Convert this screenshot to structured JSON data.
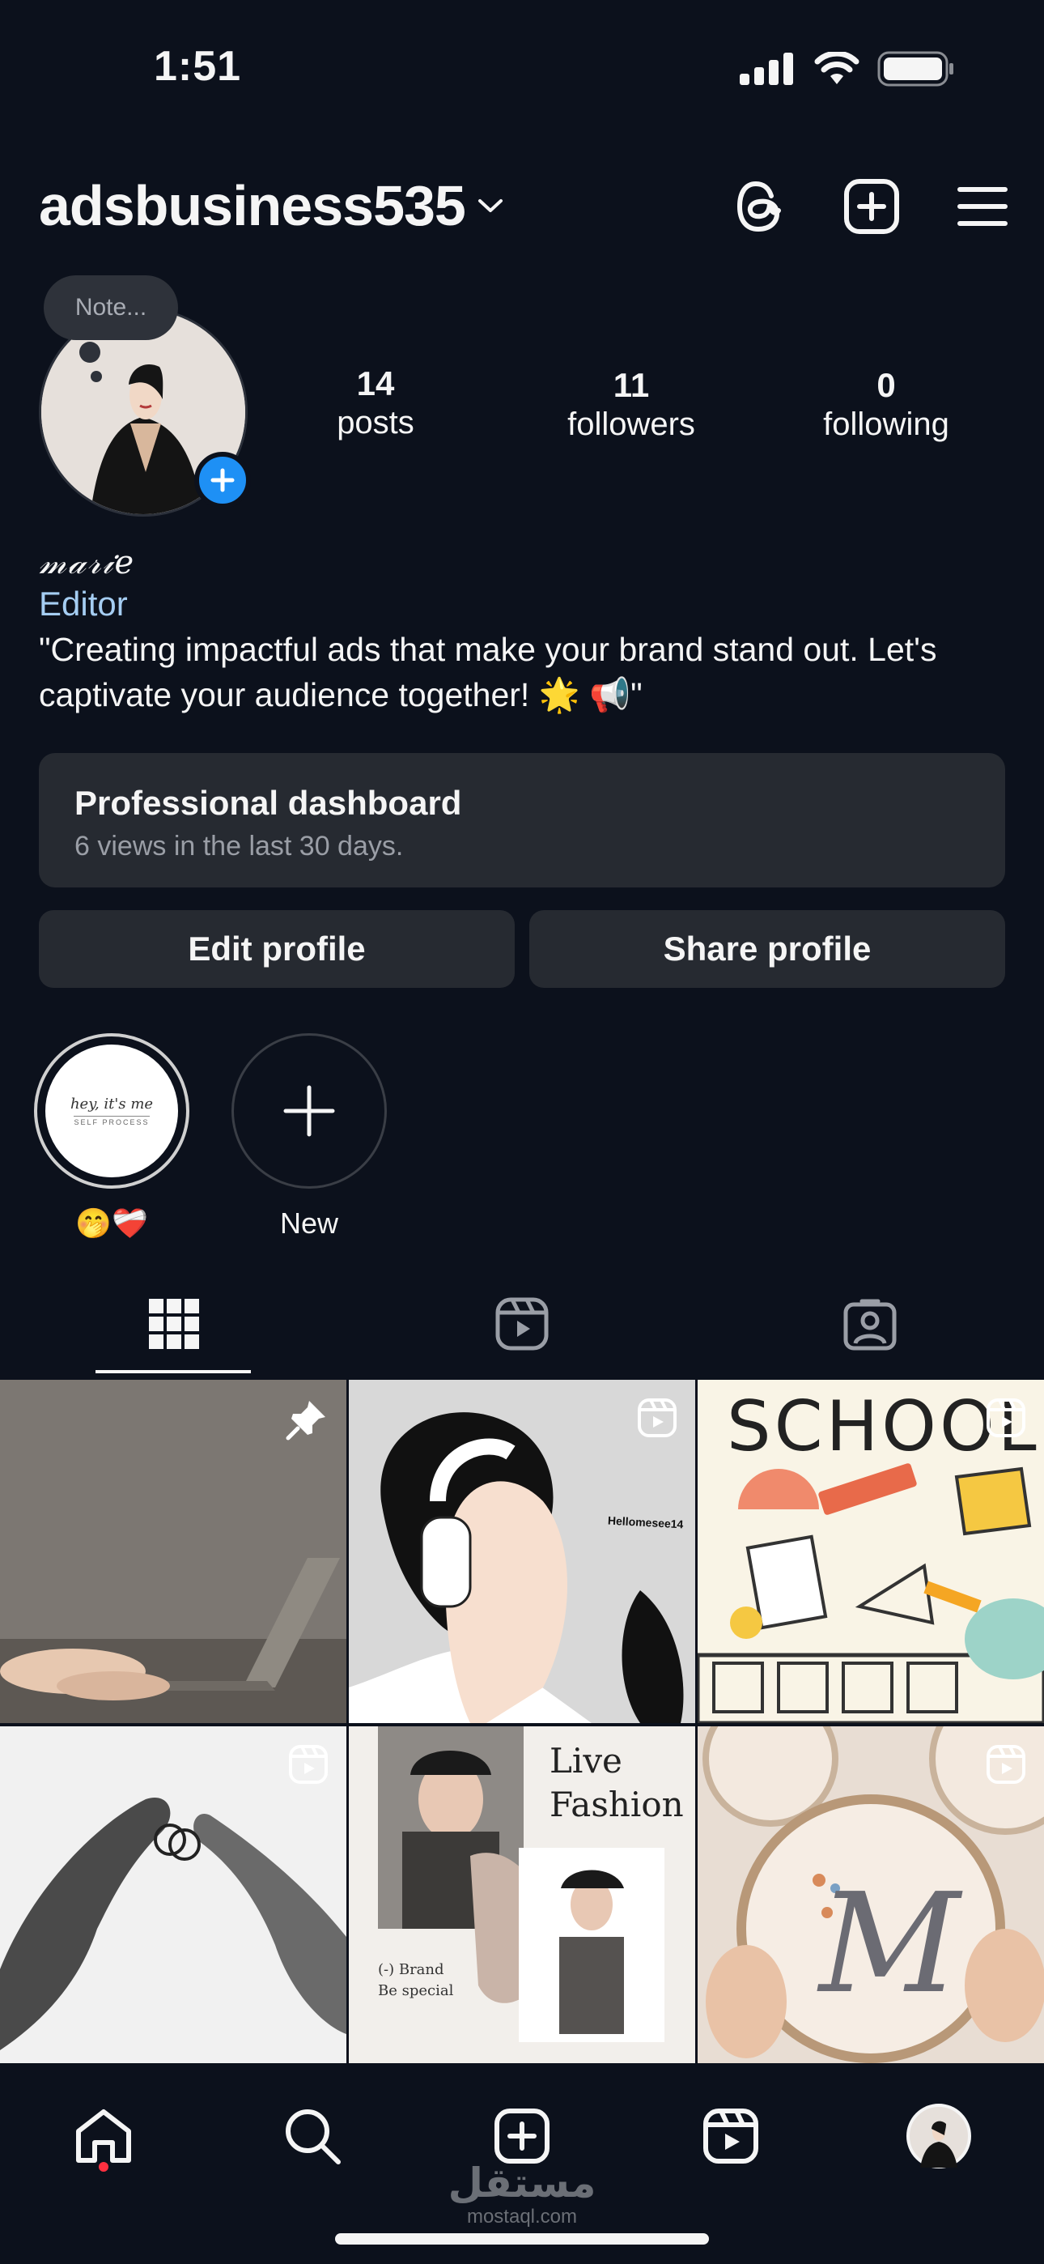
{
  "status_bar": {
    "time": "1:51"
  },
  "header": {
    "username": "adsbusiness535"
  },
  "profile": {
    "note_placeholder": "Note...",
    "stats": [
      {
        "value": "14",
        "label": "posts"
      },
      {
        "value": "11",
        "label": "followers"
      },
      {
        "value": "0",
        "label": "following"
      }
    ],
    "name": "𝓂𝒶𝓇𝒾𝑒",
    "category": "Editor",
    "bio": "\"Creating impactful ads that make your brand stand out. Let's captivate your audience together! 🌟 📢\""
  },
  "dashboard": {
    "title": "Professional dashboard",
    "subtitle": "6 views in the last 30 days."
  },
  "buttons": {
    "edit": "Edit profile",
    "share": "Share profile"
  },
  "highlights": [
    {
      "label": "🤭❤️‍🩹",
      "cover_text": "hey, it's me",
      "cover_sub": "SELF PROCESS"
    },
    {
      "label": "New"
    }
  ],
  "grid": {
    "cells": [
      {
        "type": "pinned-photo",
        "icon": "pin-icon"
      },
      {
        "type": "reel",
        "icon": "reels-icon",
        "text": "Hellomesee14"
      },
      {
        "type": "reel",
        "icon": "reels-icon",
        "text": "SCHOOL"
      },
      {
        "type": "reel",
        "icon": "reels-icon"
      },
      {
        "type": "photo",
        "title_line1": "Live",
        "title_line2": "Fashion",
        "brand": "(-) Brand",
        "tagline": "Be special"
      },
      {
        "type": "reel",
        "icon": "reels-icon",
        "text": "M"
      }
    ]
  },
  "watermark": {
    "arabic": "مستقل",
    "latin": "mostaql.com"
  },
  "colors": {
    "background": "#0c111c",
    "surface": "#262a31",
    "accent": "#1e90f5",
    "link": "#a5cdf2",
    "notification": "#ff3040"
  }
}
